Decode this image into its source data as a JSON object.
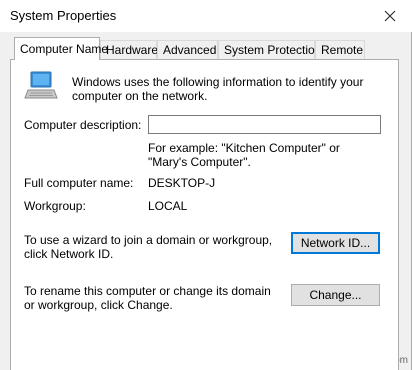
{
  "window": {
    "title": "System Properties",
    "close_icon": "close-icon"
  },
  "tabs": [
    {
      "label": "Computer Name",
      "active": true
    },
    {
      "label": "Hardware",
      "active": false
    },
    {
      "label": "Advanced",
      "active": false
    },
    {
      "label": "System Protection",
      "active": false
    },
    {
      "label": "Remote",
      "active": false
    }
  ],
  "computer_name": {
    "intro_text": "Windows uses the following information to identify your computer on the network.",
    "intro_icon": "computer-network-icon",
    "description_label": "Computer description:",
    "description_value": "",
    "description_example": "For example: \"Kitchen Computer\" or \"Mary's Computer\".",
    "full_name_label": "Full computer name:",
    "full_name_value": "DESKTOP-J",
    "workgroup_label": "Workgroup:",
    "workgroup_value": "LOCAL",
    "network_id_text": "To use a wizard to join a domain or workgroup, click Network ID.",
    "network_id_button": "Network ID...",
    "change_text": "To rename this computer or change its domain or workgroup, click Change.",
    "change_button": "Change..."
  },
  "watermark": "wsxdn.com"
}
